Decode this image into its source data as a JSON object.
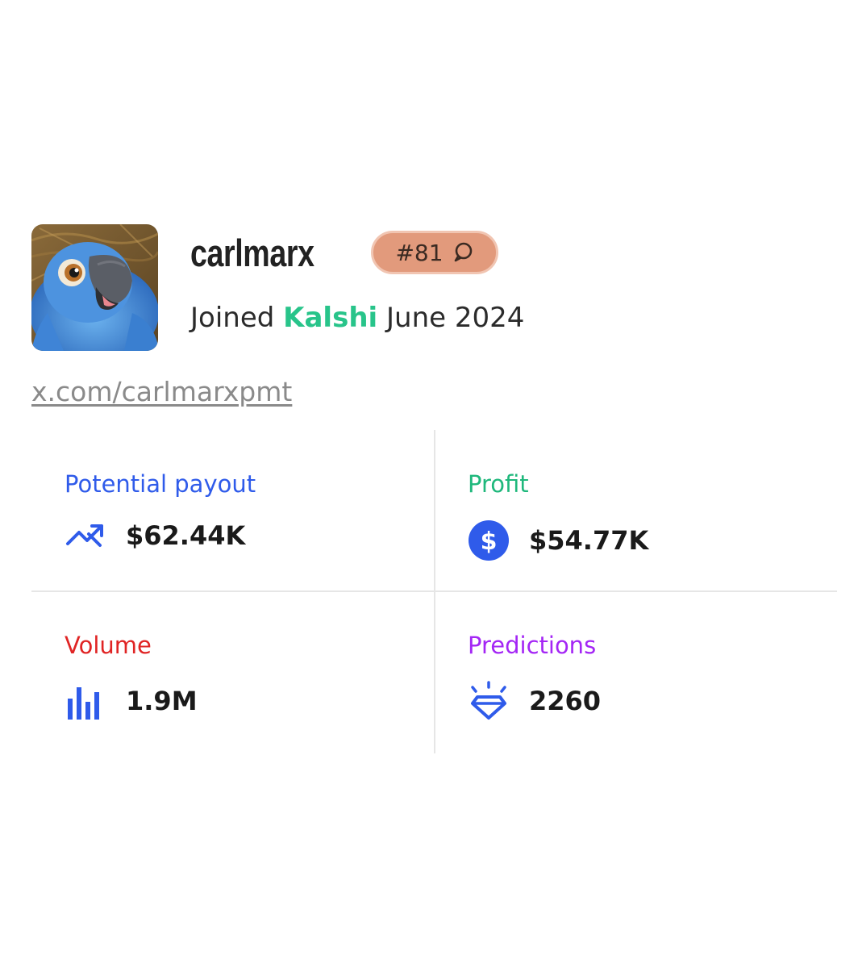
{
  "profile": {
    "username": "carlmarx",
    "rank": "#81",
    "joined_prefix": "Joined",
    "joined_brand": "Kalshi",
    "joined_date": "June 2024",
    "link": "x.com/carlmarxpmt",
    "avatar_icon": "parrot-avatar"
  },
  "stats": {
    "potential_payout": {
      "label": "Potential payout",
      "value": "$62.44K",
      "icon": "trend-up-icon",
      "label_color": "#2f5bea"
    },
    "profit": {
      "label": "Profit",
      "value": "$54.77K",
      "icon": "dollar-coin-icon",
      "label_color": "#1fb87c"
    },
    "volume": {
      "label": "Volume",
      "value": "1.9M",
      "icon": "bar-chart-icon",
      "label_color": "#e02424"
    },
    "predictions": {
      "label": "Predictions",
      "value": "2260",
      "icon": "diamond-icon",
      "label_color": "#a426f5"
    }
  },
  "colors": {
    "accent_blue": "#2f5bea",
    "brand_green": "#28c48a",
    "badge_bg": "#e29a7c"
  }
}
